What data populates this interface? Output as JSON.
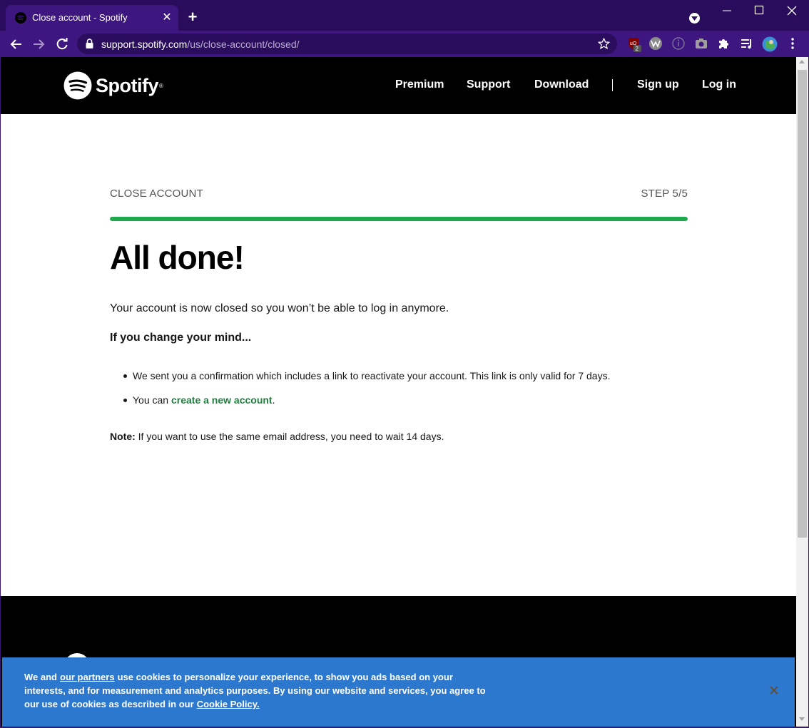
{
  "browser": {
    "tab_title": "Close account - Spotify",
    "url_domain": "support.spotify.com",
    "url_path": "/us/close-account/closed/",
    "extension_badge": "2",
    "colors": {
      "tabstrip": "#2a0c5c",
      "toolbar": "#3d1680"
    }
  },
  "header": {
    "logo_text": "Spotify",
    "logo_reg": "®",
    "nav": [
      "Premium",
      "Support",
      "Download"
    ],
    "auth": [
      "Sign up",
      "Log in"
    ]
  },
  "main": {
    "step_title": "CLOSE ACCOUNT",
    "step_count": "STEP 5/5",
    "progress_fraction": 1.0,
    "heading": "All done!",
    "paragraph": "Your account is now closed so you won’t be able to log in anymore.",
    "subheading": "If you change your mind...",
    "bullet1": "We sent you a confirmation which includes a link to reactivate your account. This link is only valid for 7 days.",
    "bullet2_prefix": "You can ",
    "bullet2_link": "create a new account",
    "bullet2_suffix": ".",
    "note_label": "Note:",
    "note_text": " If you want to use the same email address, you need to wait 14 days.",
    "accent_color": "#1ea94e"
  },
  "cookie": {
    "text_start": "We and",
    "partners_link": "our partners",
    "text_mid": "use cookies to personalize your experience, to show you ads based on your interests, and for measurement and analytics purposes. By using our website and services, you agree to our use of cookies as described in our",
    "policy_link": "Cookie Policy.",
    "background": "#2d78cf"
  }
}
